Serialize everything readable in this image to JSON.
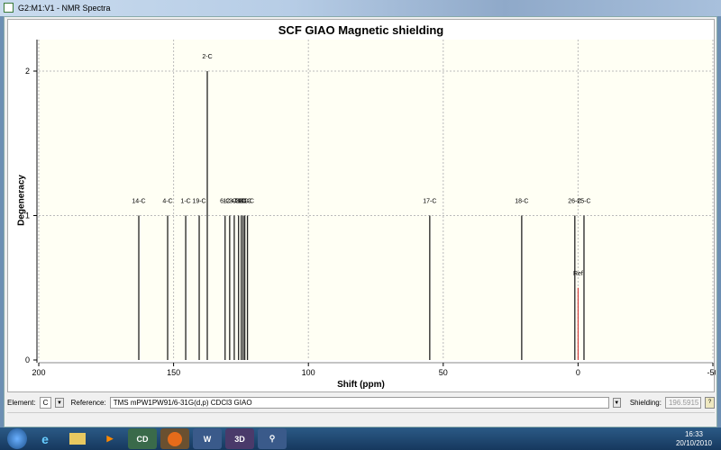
{
  "window": {
    "title": "G2:M1:V1 - NMR Spectra"
  },
  "chart_data": {
    "type": "bar",
    "title": "SCF GIAO Magnetic shielding",
    "xlabel": "Shift (ppm)",
    "ylabel": "Degeneracy",
    "xlim": [
      200,
      -50
    ],
    "ylim": [
      0,
      2.2
    ],
    "xticks": [
      200,
      150,
      100,
      50,
      0,
      -50
    ],
    "yticks": [
      0,
      1,
      2
    ],
    "grid": true,
    "peaks": [
      {
        "label": "14-C",
        "x": 162.9,
        "y": 1
      },
      {
        "label": "4-C",
        "x": 152.2,
        "y": 1
      },
      {
        "label": "1-C",
        "x": 145.5,
        "y": 1
      },
      {
        "label": "19-C",
        "x": 140.5,
        "y": 1
      },
      {
        "label": "2-C",
        "x": 137.5,
        "y": 2
      },
      {
        "label": "6-C",
        "x": 130.9,
        "y": 1
      },
      {
        "label": "12-C",
        "x": 129.2,
        "y": 1
      },
      {
        "label": "3-C",
        "x": 127.5,
        "y": 1
      },
      {
        "label": "7-C",
        "x": 125.9,
        "y": 1
      },
      {
        "label": "8-C",
        "x": 124.9,
        "y": 1
      },
      {
        "label": "9-C",
        "x": 124.2,
        "y": 1
      },
      {
        "label": "10-C",
        "x": 123.6,
        "y": 1
      },
      {
        "label": "11-C",
        "x": 122.6,
        "y": 1
      },
      {
        "label": "17-C",
        "x": 55.0,
        "y": 1
      },
      {
        "label": "18-C",
        "x": 20.9,
        "y": 1
      },
      {
        "label": "26-C",
        "x": 1.2,
        "y": 1
      },
      {
        "label": "25-C",
        "x": -2.2,
        "y": 1
      }
    ],
    "reference": {
      "label": "Ref",
      "x": 0,
      "y": 0.5,
      "color": "#cc2222"
    }
  },
  "toolbar": {
    "element_label": "Element:",
    "element_value": "C",
    "reference_label": "Reference:",
    "reference_value": "TMS mPW1PW91/6-31G(d,p) CDCl3 GIAO",
    "shielding_label": "Shielding:",
    "shielding_value": "196.5915"
  },
  "taskbar": {
    "time": "16:33",
    "date": "20/10/2010"
  }
}
